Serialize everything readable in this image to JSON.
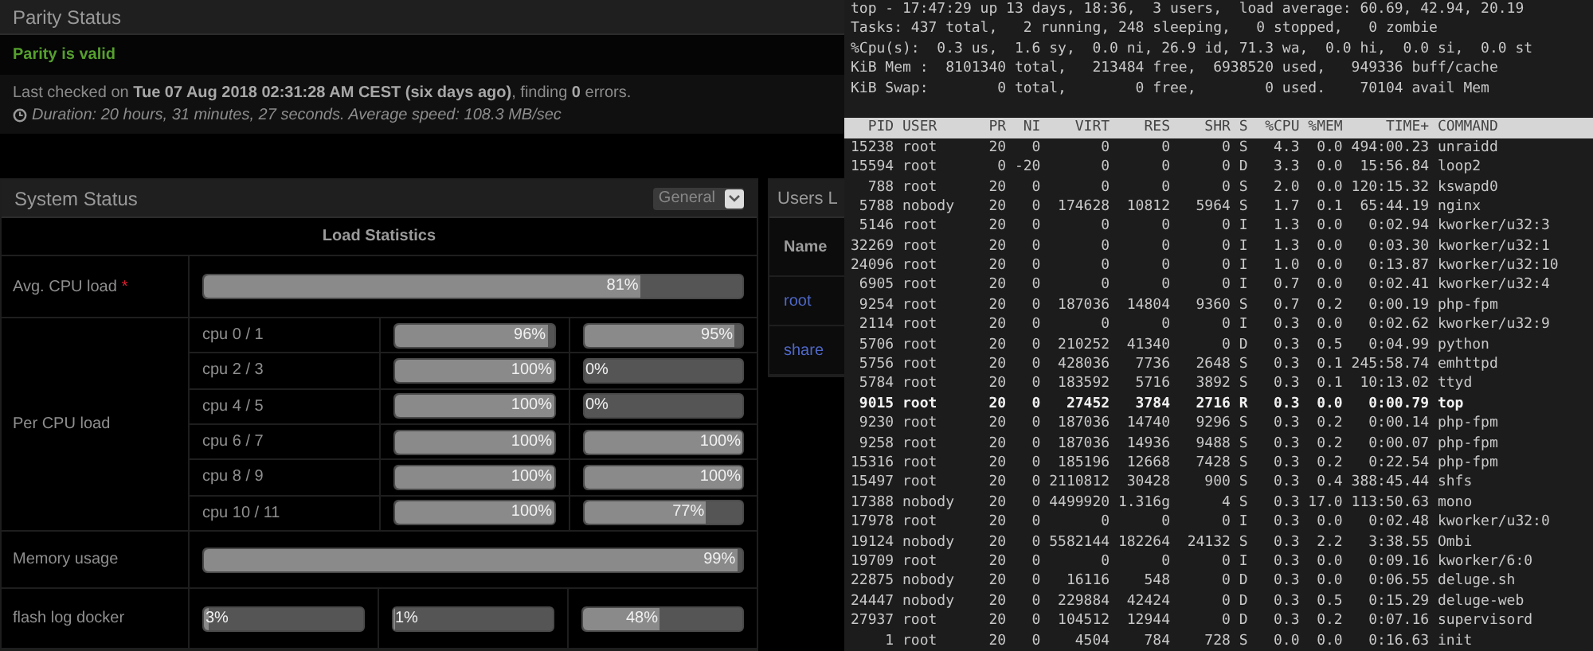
{
  "parity": {
    "title": "Parity Status",
    "status": "Parity is valid",
    "last_checked": "Last checked on **Tue 07 Aug 2018 02:31:28 AM CEST (six days ago)**, finding **0** errors.",
    "duration": "Duration: 20 hours, 31 minutes, 27 seconds. Average speed: 108.3 MB/sec"
  },
  "system_status": {
    "title": "System Status",
    "view_select": "General",
    "table_title": "Load Statistics",
    "avg_cpu": {
      "label": "Avg. CPU load",
      "required_mark": "*",
      "bar": {
        "level": 0.81,
        "reading": "81%"
      }
    },
    "per_cpu": {
      "label": "Per CPU load",
      "rows": [
        {
          "label": "cpu 0 / 1",
          "bars": [
            {
              "level": 0.96,
              "reading": "96%"
            },
            {
              "level": 0.95,
              "reading": "95%"
            }
          ]
        },
        {
          "label": "cpu 2 / 3",
          "bars": [
            {
              "level": 1,
              "reading": "100%"
            },
            {
              "reading": "0%"
            }
          ]
        },
        {
          "label": "cpu 4 / 5",
          "bars": [
            {
              "level": 1,
              "reading": "100%"
            },
            {
              "reading": "0%"
            }
          ]
        },
        {
          "label": "cpu 6 / 7",
          "bars": [
            {
              "level": 1,
              "reading": "100%"
            },
            {
              "level": 1,
              "reading": "100%"
            }
          ]
        },
        {
          "label": "cpu 8 / 9",
          "bars": [
            {
              "level": 1,
              "reading": "100%"
            },
            {
              "level": 1,
              "reading": "100%"
            }
          ]
        },
        {
          "label": "cpu 10 / 11",
          "bars": [
            {
              "level": 1,
              "reading": "100%"
            },
            {
              "level": 0.77,
              "reading": "77%"
            }
          ]
        }
      ]
    },
    "memory": {
      "label": "Memory usage",
      "bar": {
        "level": 0.99,
        "reading": "99%"
      }
    },
    "flash": {
      "label": "flash log docker",
      "bars": [
        {
          "level": 0.03,
          "reading": "3%"
        },
        {
          "level": 0.01,
          "reading": "1%"
        },
        {
          "level": 0.48,
          "reading": "48%"
        }
      ]
    }
  },
  "users": {
    "title": "Users L",
    "column": "Name",
    "rows": [
      "root",
      "share"
    ]
  },
  "terminal": {
    "summary": [
      "top - 17:47:29 up 13 days, 18:36,  3 users,  load average: 60.69, 42.94, 20.19",
      "Tasks: 437 total,   2 running, 248 sleeping,   0 stopped,   0 zombie",
      "%Cpu(s):  0.3 us,  1.6 sy,  0.0 ni, 26.9 id, 71.3 wa,  0.0 hi,  0.0 si,  0.0 st",
      "KiB Mem :  8101340 total,   213484 free,  6938520 used,   949336 buff/cache",
      "KiB Swap:        0 total,        0 free,        0 used.    70104 avail Mem"
    ],
    "columns": [
      "PID",
      "USER",
      "PR",
      "NI",
      "VIRT",
      "RES",
      "SHR",
      "S",
      "%CPU",
      "%MEM",
      "TIME+",
      "COMMAND"
    ],
    "processes": [
      {
        "cells": [
          "15238",
          "root",
          "20",
          "0",
          "0",
          "0",
          "0",
          "S",
          "4.3",
          "0.0",
          "494:00.23",
          "unraidd"
        ],
        "highlighted": false
      },
      {
        "cells": [
          "15594",
          "root",
          "0",
          "-20",
          "0",
          "0",
          "0",
          "D",
          "3.3",
          "0.0",
          "15:56.84",
          "loop2"
        ],
        "highlighted": false
      },
      {
        "cells": [
          "788",
          "root",
          "20",
          "0",
          "0",
          "0",
          "0",
          "S",
          "2.0",
          "0.0",
          "120:15.32",
          "kswapd0"
        ],
        "highlighted": false
      },
      {
        "cells": [
          "5788",
          "nobody",
          "20",
          "0",
          "174628",
          "10812",
          "5964",
          "S",
          "1.7",
          "0.1",
          "65:44.19",
          "nginx"
        ],
        "highlighted": false
      },
      {
        "cells": [
          "5146",
          "root",
          "20",
          "0",
          "0",
          "0",
          "0",
          "I",
          "1.3",
          "0.0",
          "0:02.94",
          "kworker/u32:3"
        ],
        "highlighted": false
      },
      {
        "cells": [
          "32269",
          "root",
          "20",
          "0",
          "0",
          "0",
          "0",
          "I",
          "1.3",
          "0.0",
          "0:03.30",
          "kworker/u32:1"
        ],
        "highlighted": false
      },
      {
        "cells": [
          "24096",
          "root",
          "20",
          "0",
          "0",
          "0",
          "0",
          "I",
          "1.0",
          "0.0",
          "0:13.87",
          "kworker/u32:10"
        ],
        "highlighted": false
      },
      {
        "cells": [
          "6905",
          "root",
          "20",
          "0",
          "0",
          "0",
          "0",
          "I",
          "0.7",
          "0.0",
          "0:02.41",
          "kworker/u32:4"
        ],
        "highlighted": false
      },
      {
        "cells": [
          "9254",
          "root",
          "20",
          "0",
          "187036",
          "14804",
          "9360",
          "S",
          "0.7",
          "0.2",
          "0:00.19",
          "php-fpm"
        ],
        "highlighted": false
      },
      {
        "cells": [
          "2114",
          "root",
          "20",
          "0",
          "0",
          "0",
          "0",
          "I",
          "0.3",
          "0.0",
          "0:02.62",
          "kworker/u32:9"
        ],
        "highlighted": false
      },
      {
        "cells": [
          "5706",
          "root",
          "20",
          "0",
          "210252",
          "41340",
          "0",
          "D",
          "0.3",
          "0.5",
          "0:04.99",
          "python"
        ],
        "highlighted": false
      },
      {
        "cells": [
          "5756",
          "root",
          "20",
          "0",
          "428036",
          "7736",
          "2648",
          "S",
          "0.3",
          "0.1",
          "245:58.74",
          "emhttpd"
        ],
        "highlighted": false
      },
      {
        "cells": [
          "5784",
          "root",
          "20",
          "0",
          "183592",
          "5716",
          "3892",
          "S",
          "0.3",
          "0.1",
          "10:13.02",
          "ttyd"
        ],
        "highlighted": false
      },
      {
        "cells": [
          "9015",
          "root",
          "20",
          "0",
          "27452",
          "3784",
          "2716",
          "R",
          "0.3",
          "0.0",
          "0:00.79",
          "top"
        ],
        "highlighted": true
      },
      {
        "cells": [
          "9230",
          "root",
          "20",
          "0",
          "187036",
          "14740",
          "9296",
          "S",
          "0.3",
          "0.2",
          "0:00.14",
          "php-fpm"
        ],
        "highlighted": false
      },
      {
        "cells": [
          "9258",
          "root",
          "20",
          "0",
          "187036",
          "14936",
          "9488",
          "S",
          "0.3",
          "0.2",
          "0:00.07",
          "php-fpm"
        ],
        "highlighted": false
      },
      {
        "cells": [
          "15316",
          "root",
          "20",
          "0",
          "185196",
          "12668",
          "7428",
          "S",
          "0.3",
          "0.2",
          "0:22.54",
          "php-fpm"
        ],
        "highlighted": false
      },
      {
        "cells": [
          "15497",
          "root",
          "20",
          "0",
          "2110812",
          "30428",
          "900",
          "S",
          "0.3",
          "0.4",
          "388:45.44",
          "shfs"
        ],
        "highlighted": false
      },
      {
        "cells": [
          "17388",
          "nobody",
          "20",
          "0",
          "4499920",
          "1.316g",
          "4",
          "S",
          "0.3",
          "17.0",
          "113:50.63",
          "mono"
        ],
        "highlighted": false
      },
      {
        "cells": [
          "17978",
          "root",
          "20",
          "0",
          "0",
          "0",
          "0",
          "I",
          "0.3",
          "0.0",
          "0:02.48",
          "kworker/u32:0"
        ],
        "highlighted": false
      },
      {
        "cells": [
          "19124",
          "nobody",
          "20",
          "0",
          "5582144",
          "182264",
          "24132",
          "S",
          "0.3",
          "2.2",
          "3:38.55",
          "Ombi"
        ],
        "highlighted": false
      },
      {
        "cells": [
          "19709",
          "root",
          "20",
          "0",
          "0",
          "0",
          "0",
          "I",
          "0.3",
          "0.0",
          "0:09.16",
          "kworker/6:0"
        ],
        "highlighted": false
      },
      {
        "cells": [
          "22875",
          "nobody",
          "20",
          "0",
          "16116",
          "548",
          "0",
          "D",
          "0.3",
          "0.0",
          "0:06.55",
          "deluge.sh"
        ],
        "highlighted": false
      },
      {
        "cells": [
          "24447",
          "nobody",
          "20",
          "0",
          "229884",
          "42424",
          "0",
          "D",
          "0.3",
          "0.5",
          "0:15.29",
          "deluge-web"
        ],
        "highlighted": false
      },
      {
        "cells": [
          "27937",
          "root",
          "20",
          "0",
          "104512",
          "12944",
          "0",
          "D",
          "0.3",
          "0.2",
          "0:07.16",
          "supervisord"
        ],
        "highlighted": false
      },
      {
        "cells": [
          "1",
          "root",
          "20",
          "0",
          "4504",
          "784",
          "728",
          "S",
          "0.0",
          "0.0",
          "0:16.63",
          "init"
        ],
        "highlighted": false
      }
    ]
  }
}
